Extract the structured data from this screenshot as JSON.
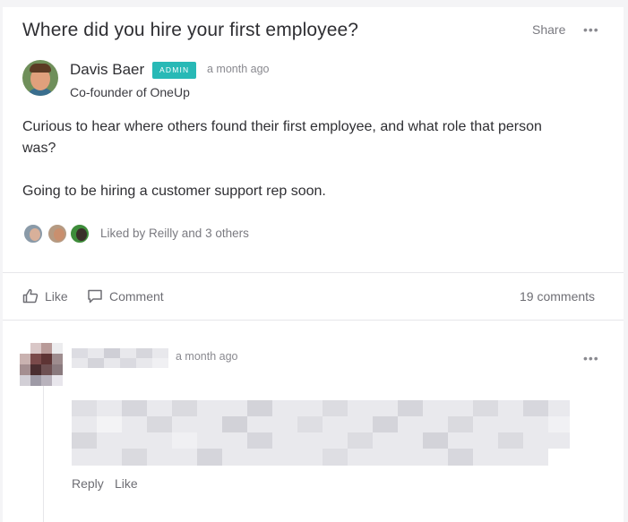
{
  "post": {
    "title": "Where did you hire your first employee?",
    "share_label": "Share",
    "more_label": "•••",
    "author": {
      "name": "Davis Baer",
      "badge": "ADMIN",
      "time": "a month ago",
      "role": "Co-founder of OneUp"
    },
    "body": [
      "Curious to hear where others found their first employee, and what role that person was?",
      "Going to be hiring a customer support rep soon."
    ],
    "liked_by": "Liked by Reilly and 3 others"
  },
  "actions": {
    "like_label": "Like",
    "comment_label": "Comment",
    "comments_count": "19 comments"
  },
  "comment": {
    "time": "a month ago",
    "more_label": "•••",
    "reply_label": "Reply",
    "like_label": "Like"
  },
  "colors": {
    "badge": "#28b9b6",
    "muted_text": "#7a7a80",
    "card": "#ffffff",
    "page_bg": "#f4f4f6"
  }
}
